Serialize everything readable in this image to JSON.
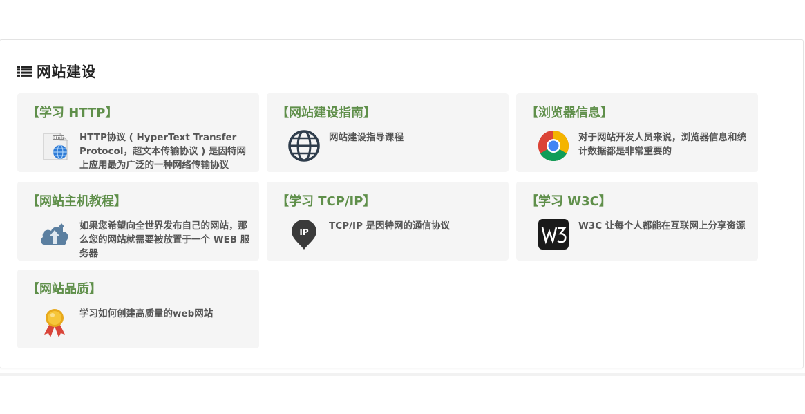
{
  "section": {
    "title": "网站建设",
    "icon": "list-icon"
  },
  "colors": {
    "card_title": "#5f8f4a",
    "card_bg": "#f5f5f5",
    "description": "#555555"
  },
  "cards": [
    {
      "title": "【学习 HTTP】",
      "desc": "HTTP协议 ( HyperText Transfer Protocol，超文本传输协议 ) 是因特网上应用最为广泛的一种网络传输协议",
      "icon": "http-document-icon"
    },
    {
      "title": "【网站建设指南】",
      "desc": "网站建设指导课程",
      "icon": "globe-icon"
    },
    {
      "title": "【浏览器信息】",
      "desc": "对于网站开发人员来说，浏览器信息和统计数据都是非常重要的",
      "icon": "chrome-icon"
    },
    {
      "title": "【网站主机教程】",
      "desc": "如果您希望向全世界发布自己的网站，那么您的网站就需要被放置于一个 WEB 服务器",
      "icon": "cloud-upload-icon"
    },
    {
      "title": "【学习 TCP/IP】",
      "desc": "TCP/IP 是因特网的通信协议",
      "icon": "ip-pin-icon"
    },
    {
      "title": "【学习 W3C】",
      "desc": "W3C 让每个人都能在互联网上分享资源",
      "icon": "w3c-icon"
    },
    {
      "title": "【网站品质】",
      "desc": "学习如何创建高质量的web网站",
      "icon": "award-ribbon-icon"
    }
  ]
}
